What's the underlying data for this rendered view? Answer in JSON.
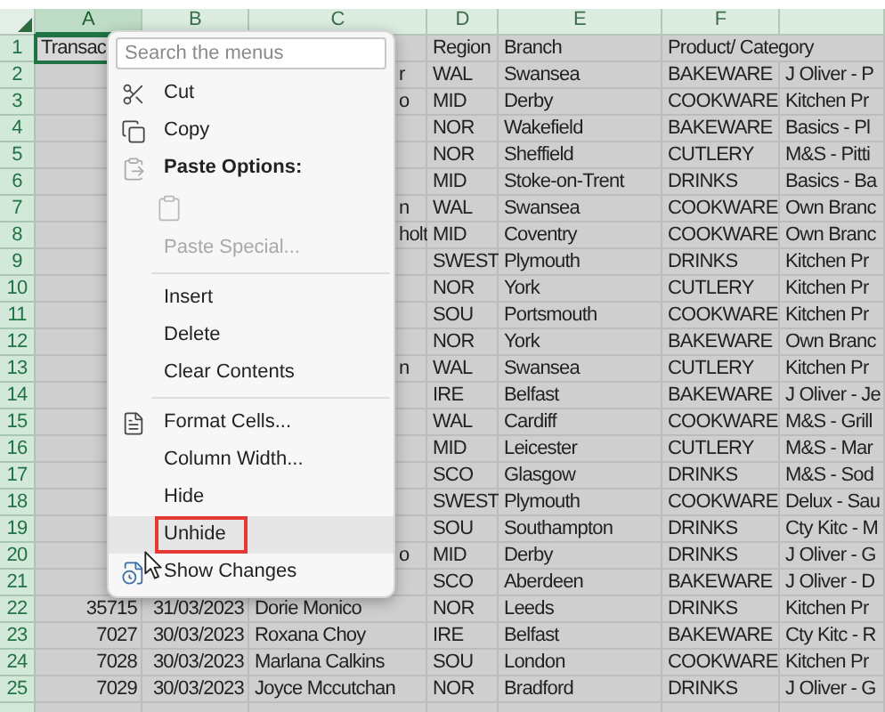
{
  "columns": [
    {
      "label": "A",
      "selected": true
    },
    {
      "label": "B",
      "selected": false
    },
    {
      "label": "C",
      "selected": false
    },
    {
      "label": "D",
      "selected": false
    },
    {
      "label": "E",
      "selected": false
    },
    {
      "label": "F",
      "selected": false
    }
  ],
  "rows": [
    {
      "number": "1",
      "cells": {
        "A": "Transac",
        "D": "Region",
        "E": "Branch",
        "F": "Product/ Category"
      }
    },
    {
      "number": "2",
      "cells": {
        "C": "r",
        "D": "WAL",
        "E": "Swansea",
        "F": "BAKEWARE",
        "G": "J Oliver - P"
      }
    },
    {
      "number": "3",
      "cells": {
        "C": "o",
        "D": "MID",
        "E": "Derby",
        "F": "COOKWARE",
        "G": "Kitchen Pr"
      }
    },
    {
      "number": "4",
      "cells": {
        "D": "NOR",
        "E": "Wakefield",
        "F": "BAKEWARE",
        "G": "Basics - Pl"
      }
    },
    {
      "number": "5",
      "cells": {
        "D": "NOR",
        "E": "Sheffield",
        "F": "CUTLERY",
        "G": "M&S - Pitti"
      }
    },
    {
      "number": "6",
      "cells": {
        "D": "MID",
        "E": "Stoke-on-Trent",
        "F": "DRINKS",
        "G": "Basics - Ba"
      }
    },
    {
      "number": "7",
      "cells": {
        "C": "n",
        "D": "WAL",
        "E": "Swansea",
        "F": "COOKWARE",
        "G": "Own Branc"
      }
    },
    {
      "number": "8",
      "cells": {
        "C": "holt",
        "D": "MID",
        "E": "Coventry",
        "F": "COOKWARE",
        "G": "Own Branc"
      }
    },
    {
      "number": "9",
      "cells": {
        "D": "SWEST",
        "E": "Plymouth",
        "F": "DRINKS",
        "G": "Kitchen Pr"
      }
    },
    {
      "number": "10",
      "cells": {
        "D": "NOR",
        "E": "York",
        "F": "CUTLERY",
        "G": "Kitchen Pr"
      }
    },
    {
      "number": "11",
      "cells": {
        "D": "SOU",
        "E": "Portsmouth",
        "F": "COOKWARE",
        "G": "Kitchen Pr"
      }
    },
    {
      "number": "12",
      "cells": {
        "D": "NOR",
        "E": "York",
        "F": "BAKEWARE",
        "G": "Own Branc"
      }
    },
    {
      "number": "13",
      "cells": {
        "C": "n",
        "D": "WAL",
        "E": "Swansea",
        "F": "CUTLERY",
        "G": "Kitchen Pr"
      }
    },
    {
      "number": "14",
      "cells": {
        "D": "IRE",
        "E": "Belfast",
        "F": "BAKEWARE",
        "G": "J Oliver - Je"
      }
    },
    {
      "number": "15",
      "cells": {
        "D": "WAL",
        "E": "Cardiff",
        "F": "COOKWARE",
        "G": "M&S - Grill"
      }
    },
    {
      "number": "16",
      "cells": {
        "D": "MID",
        "E": "Leicester",
        "F": "CUTLERY",
        "G": "M&S - Mar"
      }
    },
    {
      "number": "17",
      "cells": {
        "D": "SCO",
        "E": "Glasgow",
        "F": "DRINKS",
        "G": "M&S - Sod"
      }
    },
    {
      "number": "18",
      "cells": {
        "D": "SWEST",
        "E": "Plymouth",
        "F": "COOKWARE",
        "G": "Delux - Sau"
      }
    },
    {
      "number": "19",
      "cells": {
        "D": "SOU",
        "E": "Southampton",
        "F": "DRINKS",
        "G": "Cty Kitc - M"
      }
    },
    {
      "number": "20",
      "cells": {
        "C": "o",
        "D": "MID",
        "E": "Derby",
        "F": "DRINKS",
        "G": "J Oliver - G"
      }
    },
    {
      "number": "21",
      "cells": {
        "D": "SCO",
        "E": "Aberdeen",
        "F": "BAKEWARE",
        "G": "J Oliver - D"
      }
    },
    {
      "number": "22",
      "cells": {
        "A": "35715",
        "B": "31/03/2023",
        "C": "Dorie Monico",
        "D": "NOR",
        "E": "Leeds",
        "F": "DRINKS",
        "G": "Kitchen Pr"
      }
    },
    {
      "number": "23",
      "cells": {
        "A": "7027",
        "B": "30/03/2023",
        "C": "Roxana Choy",
        "D": "IRE",
        "E": "Belfast",
        "F": "BAKEWARE",
        "G": "Cty Kitc - R"
      }
    },
    {
      "number": "24",
      "cells": {
        "A": "7028",
        "B": "30/03/2023",
        "C": "Marlana Calkins",
        "D": "SOU",
        "E": "London",
        "F": "COOKWARE",
        "G": "Kitchen Pr"
      }
    },
    {
      "number": "25",
      "cells": {
        "A": "7029",
        "B": "30/03/2023",
        "C": "Joyce Mccutchan",
        "D": "NOR",
        "E": "Bradford",
        "F": "DRINKS",
        "G": "J Oliver - G"
      }
    }
  ],
  "context_menu": {
    "search": {
      "placeholder": "Search the menus"
    },
    "items": [
      {
        "kind": "command",
        "label": "Cut",
        "disabled": false,
        "highlighted": false
      },
      {
        "kind": "command",
        "label": "Copy",
        "disabled": false,
        "highlighted": false
      },
      {
        "kind": "heading",
        "label": "Paste Options:"
      },
      {
        "kind": "paste-icon",
        "disabled": true
      },
      {
        "kind": "command",
        "label": "Paste Special...",
        "disabled": true,
        "highlighted": false
      },
      {
        "kind": "separator"
      },
      {
        "kind": "command",
        "label": "Insert",
        "disabled": false,
        "highlighted": false
      },
      {
        "kind": "command",
        "label": "Delete",
        "disabled": false,
        "highlighted": false
      },
      {
        "kind": "command",
        "label": "Clear Contents",
        "disabled": false,
        "highlighted": false
      },
      {
        "kind": "separator"
      },
      {
        "kind": "command",
        "label": "Format Cells...",
        "disabled": false,
        "highlighted": false
      },
      {
        "kind": "command",
        "label": "Column Width...",
        "disabled": false,
        "highlighted": false
      },
      {
        "kind": "command",
        "label": "Hide",
        "disabled": false,
        "highlighted": false
      },
      {
        "kind": "command",
        "label": "Unhide",
        "disabled": false,
        "highlighted": true
      },
      {
        "kind": "command",
        "label": "Show Changes",
        "disabled": false,
        "highlighted": false
      }
    ]
  }
}
